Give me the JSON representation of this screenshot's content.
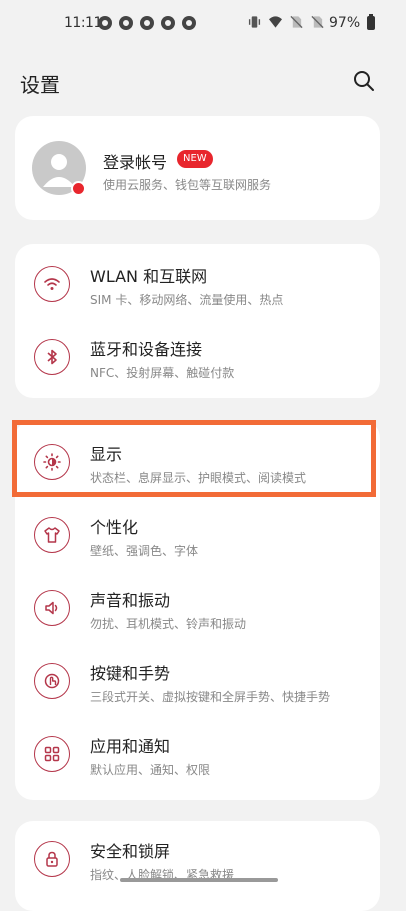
{
  "status_bar": {
    "time": "11:11",
    "battery": "97%",
    "notification_icons": [
      "weather-icon",
      "weather-icon",
      "chat-icon",
      "chat-icon",
      "chat-icon"
    ],
    "system_icons": [
      "vibrate-icon",
      "wifi-icon",
      "no-sim-icon",
      "no-sim-icon"
    ]
  },
  "header": {
    "title": "设置",
    "search_icon": "search-icon"
  },
  "account": {
    "title": "登录帐号",
    "badge": "NEW",
    "subtitle": "使用云服务、钱包等互联网服务"
  },
  "accent_color": "#b4364a",
  "highlight_color": "#f26b37",
  "group1": [
    {
      "icon": "wifi-icon",
      "title": "WLAN 和互联网",
      "subtitle": "SIM 卡、移动网络、流量使用、热点"
    },
    {
      "icon": "bluetooth-icon",
      "title": "蓝牙和设备连接",
      "subtitle": "NFC、投射屏幕、触碰付款"
    }
  ],
  "group2": [
    {
      "icon": "brightness-icon",
      "title": "显示",
      "subtitle": "状态栏、息屏显示、护眼模式、阅读模式"
    },
    {
      "icon": "tshirt-icon",
      "title": "个性化",
      "subtitle": "壁纸、强调色、字体"
    },
    {
      "icon": "speaker-icon",
      "title": "声音和振动",
      "subtitle": "勿扰、耳机模式、铃声和振动"
    },
    {
      "icon": "gesture-icon",
      "title": "按键和手势",
      "subtitle": "三段式开关、虚拟按键和全屏手势、快捷手势"
    },
    {
      "icon": "apps-icon",
      "title": "应用和通知",
      "subtitle": "默认应用、通知、权限"
    }
  ],
  "group3": [
    {
      "icon": "lock-icon",
      "title": "安全和锁屏",
      "subtitle": "指纹、人脸解锁、紧急救援"
    }
  ]
}
